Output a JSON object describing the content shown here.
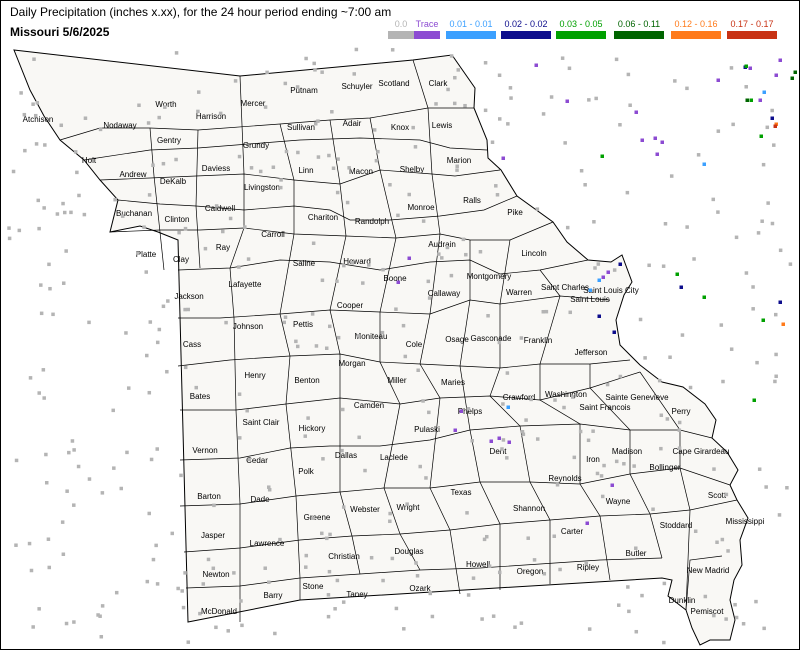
{
  "header": {
    "title": "Daily Precipitation (inches  x.xx),  for the 24 hour period ending ~7:00 am",
    "subtitle": "Missouri 5/6/2025"
  },
  "legend": [
    {
      "label": "0.0",
      "color": "#b4b4b4",
      "label_color": "#b4b4b4"
    },
    {
      "label": "Trace",
      "color": "#8c4bd2",
      "label_color": "#8c4bd2"
    },
    {
      "label": "0.01 - 0.01",
      "color": "#3ba0ff",
      "label_color": "#3ba0ff"
    },
    {
      "label": "0.02 - 0.02",
      "color": "#0d0d8c",
      "label_color": "#0d0d8c"
    },
    {
      "label": "0.03 - 0.05",
      "color": "#00a000",
      "label_color": "#00a000"
    },
    {
      "label": "0.06 - 0.11",
      "color": "#006400",
      "label_color": "#006400"
    },
    {
      "label": "0.12 - 0.16",
      "color": "#ff7a1a",
      "label_color": "#ff7a1a"
    },
    {
      "label": "0.17 - 0.17",
      "color": "#c83214",
      "label_color": "#c83214"
    }
  ],
  "counties": [
    "Atchison",
    "Nodaway",
    "Worth",
    "Harrison",
    "Mercer",
    "Putnam",
    "Schuyler",
    "Scotland",
    "Clark",
    "Holt",
    "Andrew",
    "Gentry",
    "DeKalb",
    "Daviess",
    "Grundy",
    "Sullivan",
    "Adair",
    "Knox",
    "Lewis",
    "Buchanan",
    "Clinton",
    "Caldwell",
    "Livingston",
    "Linn",
    "Macon",
    "Shelby",
    "Marion",
    "Platte",
    "Clay",
    "Ray",
    "Carroll",
    "Chariton",
    "Randolph",
    "Monroe",
    "Ralls",
    "Pike",
    "Jackson",
    "Lafayette",
    "Saline",
    "Howard",
    "Boone",
    "Audrain",
    "Montgomery",
    "Lincoln",
    "Cass",
    "Johnson",
    "Pettis",
    "Cooper",
    "Moniteau",
    "Cole",
    "Callaway",
    "Osage",
    "Gasconade",
    "Warren",
    "Saint Charles",
    "Saint Louis",
    "Saint Louis City",
    "Franklin",
    "Jefferson",
    "Bates",
    "Henry",
    "Benton",
    "Morgan",
    "Miller",
    "Maries",
    "Camden",
    "Crawford",
    "Washington",
    "Saint Francois",
    "Sainte Genevieve",
    "Perry",
    "Vernon",
    "Saint Clair",
    "Hickory",
    "Dallas",
    "Laclede",
    "Pulaski",
    "Phelps",
    "Dent",
    "Iron",
    "Madison",
    "Cape Girardeau",
    "Bollinger",
    "Barton",
    "Cedar",
    "Polk",
    "Dade",
    "Greene",
    "Webster",
    "Wright",
    "Texas",
    "Shannon",
    "Reynolds",
    "Wayne",
    "Scott",
    "Stoddard",
    "Mississippi",
    "Jasper",
    "Lawrence",
    "Christian",
    "Douglas",
    "Howell",
    "Oregon",
    "Ripley",
    "Carter",
    "Butler",
    "New Madrid",
    "Newton",
    "Barry",
    "Stone",
    "Taney",
    "Ozark",
    "McDonald",
    "Dunklin",
    "Pemiscot"
  ],
  "stations": {
    "zero_count": 420,
    "trace": [
      [
        409,
        258
      ],
      [
        398,
        282
      ],
      [
        655,
        138
      ],
      [
        662,
        142
      ],
      [
        657,
        154
      ],
      [
        642,
        140
      ],
      [
        636,
        112
      ],
      [
        503,
        158
      ],
      [
        567,
        101
      ],
      [
        455,
        430
      ],
      [
        461,
        411
      ],
      [
        491,
        441
      ],
      [
        509,
        442
      ],
      [
        499,
        438
      ],
      [
        587,
        523
      ],
      [
        612,
        485
      ],
      [
        603,
        277
      ],
      [
        608,
        272
      ],
      [
        536,
        65
      ],
      [
        780,
        60
      ],
      [
        776,
        75
      ],
      [
        760,
        100
      ],
      [
        750,
        68
      ],
      [
        718,
        80
      ]
    ],
    "p001": [
      [
        508,
        407
      ],
      [
        704,
        164
      ],
      [
        764,
        92
      ],
      [
        599,
        280
      ],
      [
        590,
        290
      ]
    ],
    "p002": [
      [
        780,
        302
      ],
      [
        681,
        287
      ],
      [
        614,
        332
      ],
      [
        599,
        316
      ],
      [
        620,
        264
      ],
      [
        745,
        67
      ],
      [
        772,
        118
      ]
    ],
    "p003": [
      [
        602,
        156
      ],
      [
        677,
        274
      ],
      [
        704,
        297
      ],
      [
        754,
        400
      ],
      [
        763,
        320
      ],
      [
        761,
        136
      ],
      [
        751,
        100
      ],
      [
        746,
        66
      ]
    ],
    "p006": [
      [
        795,
        72
      ],
      [
        792,
        78
      ],
      [
        747,
        100
      ]
    ],
    "p012": [
      [
        783,
        324
      ],
      [
        776,
        124
      ]
    ],
    "p017": [
      [
        775,
        126
      ]
    ]
  }
}
